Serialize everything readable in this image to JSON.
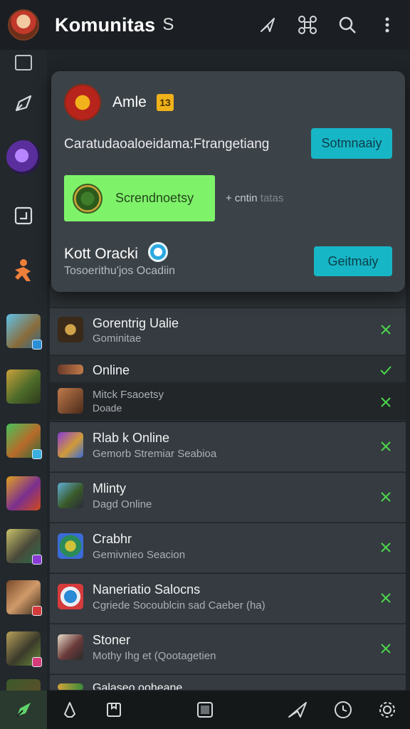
{
  "header": {
    "title": "Komunitas",
    "title_glyph": "S"
  },
  "card": {
    "name": "Amle",
    "badge": "13",
    "line1": "Caratudaoaloeidama:Ftrangetiang",
    "button1": "Sotmnaaiy",
    "green_label": "Screndnoetsy",
    "add_text": "+ cntin",
    "add_text_faint": "tatas",
    "kname": "Kott Oracki",
    "ksub": "Tosoerithu'jos Ocadiin",
    "button2": "Geitmaiy"
  },
  "rows": [
    {
      "title": "Gorentrig Ualie",
      "subtitle": "Gominitae"
    },
    {
      "title": "Online",
      "subtitle": ""
    },
    {
      "title": "Mitck Fsaoetsy",
      "subtitle": "Doade"
    },
    {
      "title": "Rlab k Online",
      "subtitle": "Gemorb Stremiar Seabioa"
    },
    {
      "title": "Mlinty",
      "subtitle": "Dagd Online"
    },
    {
      "title": "Crabhr",
      "subtitle": "Gemivnieo Seacion"
    },
    {
      "title": "Naneriatio Salocns",
      "subtitle": "Cgriede Socoublcin sad Caeber (ha)"
    },
    {
      "title": "Stoner",
      "subtitle": "Mothy Ihg et (Qootagetien"
    },
    {
      "title": "Galaseo ooheane",
      "subtitle": ""
    }
  ],
  "colors": {
    "accent_cyan": "#17b6c6",
    "accent_green": "#7ef36a",
    "check_green": "#4bd64a",
    "badge_gold": "#f0b21a"
  },
  "icons": {
    "top_actions": [
      "send-icon",
      "drone-icon",
      "search-icon",
      "more-vert-icon"
    ],
    "bottom_nav": [
      "rocket-icon",
      "person-icon",
      "bookmark-icon",
      "square-icon",
      "send-icon",
      "clock-icon",
      "gear-icon"
    ]
  }
}
